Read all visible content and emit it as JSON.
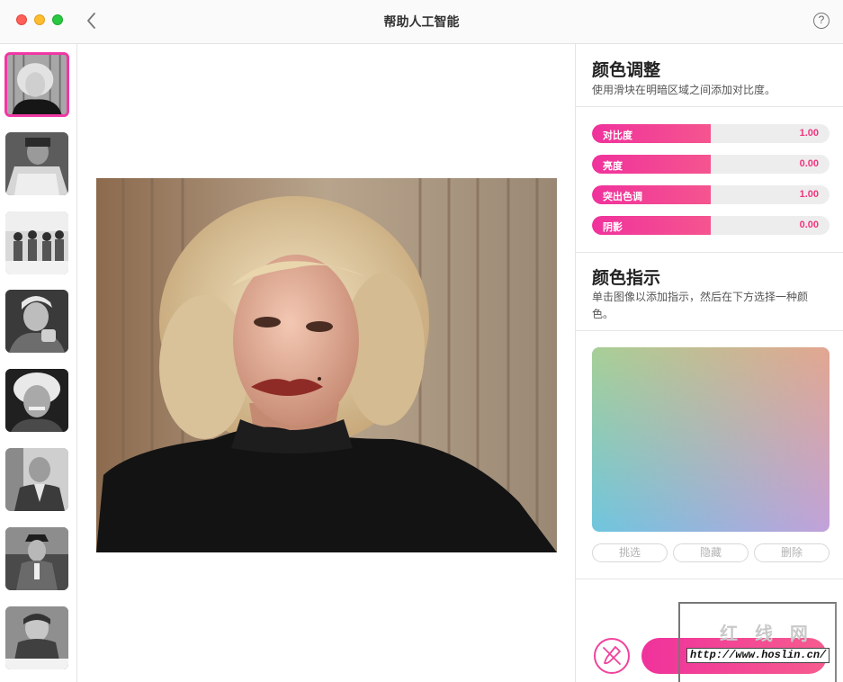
{
  "window": {
    "title": "帮助人工智能",
    "help_icon": "?"
  },
  "icons": {
    "back": "chevron-left-icon",
    "help": "question-circle-icon",
    "brush": "brush-icon"
  },
  "colors": {
    "accent": "#f0329c",
    "accent_text": "#f0367f"
  },
  "sidebar": {
    "thumbnails": [
      {
        "name": "thumbnail-1",
        "selected": true
      },
      {
        "name": "thumbnail-2",
        "selected": false
      },
      {
        "name": "thumbnail-3",
        "selected": false
      },
      {
        "name": "thumbnail-4",
        "selected": false
      },
      {
        "name": "thumbnail-5",
        "selected": false
      },
      {
        "name": "thumbnail-6",
        "selected": false
      },
      {
        "name": "thumbnail-7",
        "selected": false
      },
      {
        "name": "thumbnail-8",
        "selected": false
      }
    ]
  },
  "color_adjust": {
    "title": "颜色调整",
    "description": "使用滑块在明暗区域之间添加对比度。",
    "sliders": [
      {
        "label": "对比度",
        "value": "1.00"
      },
      {
        "label": "亮度",
        "value": "0.00"
      },
      {
        "label": "突出色调",
        "value": "1.00"
      },
      {
        "label": "阴影",
        "value": "0.00"
      }
    ]
  },
  "color_hint": {
    "title": "颜色指示",
    "description": "单击图像以添加指示，然后在下方选择一种颜色。",
    "buttons": {
      "pick": "挑选",
      "hide": "隐藏",
      "delete": "删除"
    }
  },
  "watermark": {
    "logo": "红 线 网",
    "url": "http://www.hoslin.cn/"
  }
}
